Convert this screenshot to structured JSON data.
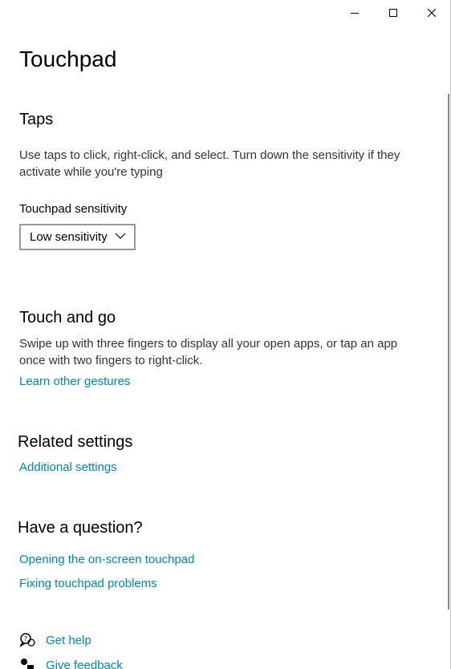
{
  "window": {
    "title": "Touchpad"
  },
  "caption": {
    "minimize": "minimize-icon",
    "maximize": "maximize-icon",
    "close": "close-icon"
  },
  "taps": {
    "heading": "Taps",
    "description": "Use taps to click, right-click, and select. Turn down the sensitivity if they activate while you're typing",
    "sensitivity_label": "Touchpad sensitivity",
    "sensitivity_value": "Low sensitivity"
  },
  "touch_and_go": {
    "heading": "Touch and go",
    "description": "Swipe up with three fingers to display all your open apps, or tap an app once with two fingers to right-click.",
    "link": "Learn other gestures"
  },
  "related": {
    "heading": "Related settings",
    "link": "Additional settings"
  },
  "question": {
    "heading": "Have a question?",
    "links": [
      "Opening the on-screen touchpad",
      "Fixing touchpad problems"
    ]
  },
  "help": {
    "get_help": "Get help",
    "give_feedback": "Give feedback"
  },
  "colors": {
    "link": "#0086b3",
    "text": "#000000",
    "secondary_text": "#333333"
  }
}
